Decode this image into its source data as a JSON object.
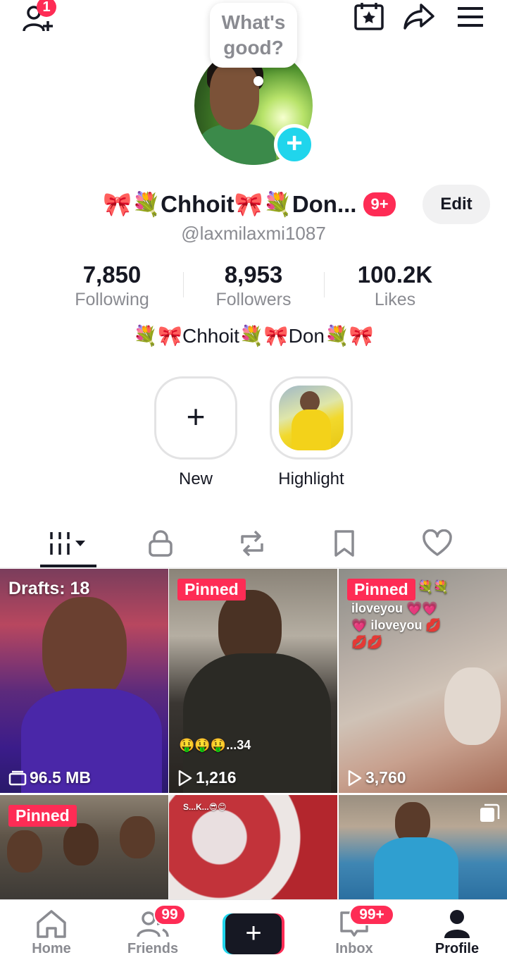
{
  "header": {
    "add_friend_badge": "1",
    "icons": [
      "add-friend-icon",
      "calendar-star-icon",
      "share-icon",
      "menu-icon"
    ]
  },
  "bubble": {
    "line1": "What's",
    "line2": "good?"
  },
  "profile": {
    "display_name": "🎀💐Chhoit🎀💐Don...",
    "notification_badge": "9+",
    "edit_label": "Edit",
    "handle": "@laxmilaxmi1087",
    "bio": "💐🎀Chhoit💐🎀Don💐🎀"
  },
  "stats": {
    "following": {
      "value": "7,850",
      "label": "Following"
    },
    "followers": {
      "value": "8,953",
      "label": "Followers"
    },
    "likes": {
      "value": "100.2K",
      "label": "Likes"
    }
  },
  "stories": {
    "new_label": "New",
    "highlight_label": "Highlight"
  },
  "tabs": [
    "videos-grid-tab",
    "private-tab",
    "reposts-tab",
    "favorites-tab",
    "liked-tab"
  ],
  "videos": [
    {
      "overlay": "Drafts: 18",
      "meta": "96.5 MB",
      "caption": ""
    },
    {
      "overlay": "Pinned",
      "meta": "1,216",
      "caption": "🤑🤑🤑...34"
    },
    {
      "overlay": "Pinned",
      "meta": "3,760",
      "caption": "iloveyou 💗💗💗 iloveyou 💋💋💋",
      "tag_emoji": "💐💐"
    },
    {
      "overlay": "Pinned",
      "meta": "",
      "caption": ""
    },
    {
      "overlay": "",
      "meta": "",
      "caption": "S...K...😎😊"
    },
    {
      "overlay": "",
      "meta": "",
      "caption": ""
    }
  ],
  "bottom_nav": {
    "home": "Home",
    "friends": "Friends",
    "friends_badge": "99",
    "inbox": "Inbox",
    "inbox_badge": "99+",
    "profile": "Profile"
  },
  "colors": {
    "accent": "#fe2c55",
    "cyan": "#20d5ec",
    "text": "#161823",
    "muted": "#8a8b91"
  }
}
